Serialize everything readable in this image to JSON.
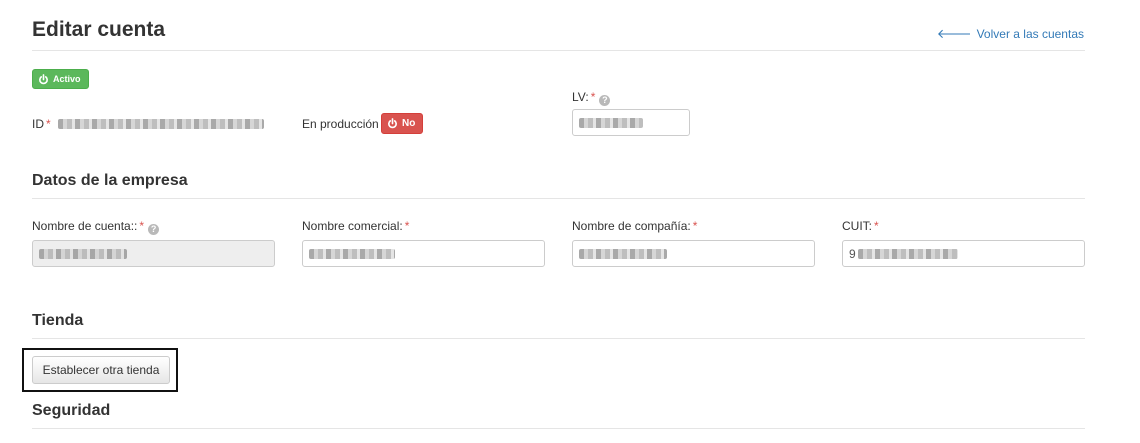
{
  "header": {
    "title": "Editar cuenta",
    "back_link": "Volver a las cuentas"
  },
  "status": {
    "active_label": "Activo",
    "active_color": "#5cb85c"
  },
  "top_fields": {
    "id_label": "ID",
    "production_label": "En producción",
    "production_value": "No",
    "production_color": "#d9534f",
    "lv_label": "LV:"
  },
  "company": {
    "section_title": "Datos de la empresa",
    "account_name_label": "Nombre de cuenta::",
    "commercial_name_label": "Nombre comercial:",
    "company_name_label": "Nombre de compañía:",
    "cuit_label": "CUIT:",
    "cuit_prefix": "9"
  },
  "store": {
    "section_title": "Tienda",
    "set_store_button": "Establecer otra tienda"
  },
  "security": {
    "section_title": "Seguridad"
  },
  "required_mark": "*",
  "help_glyph": "?"
}
